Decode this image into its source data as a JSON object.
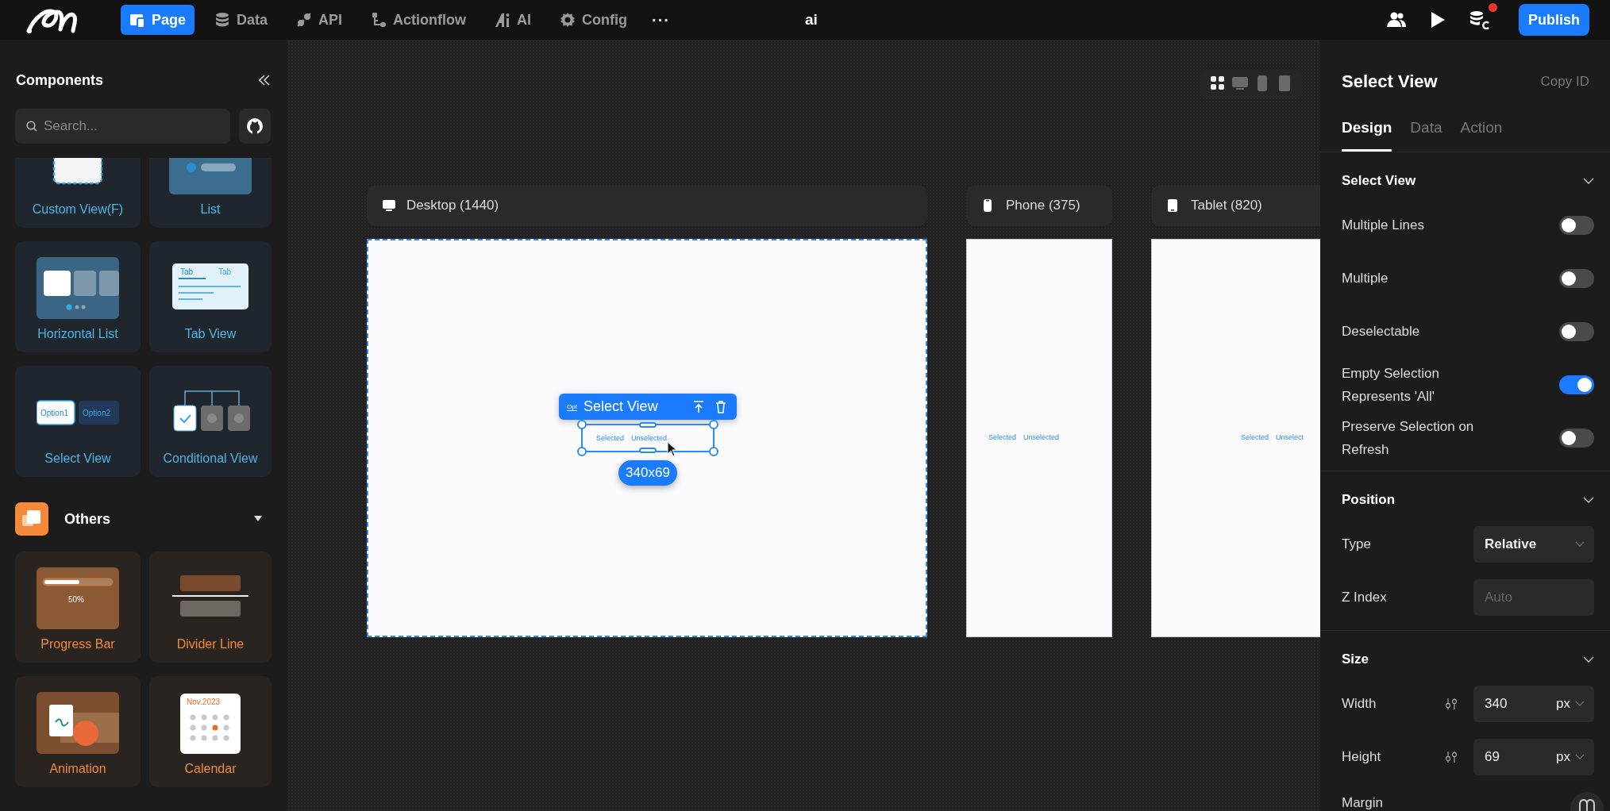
{
  "topbar": {
    "nav": [
      {
        "kind": "page",
        "label": "Page",
        "selected": true
      },
      {
        "kind": "data",
        "label": "Data",
        "selected": false
      },
      {
        "kind": "api",
        "label": "API",
        "selected": false
      },
      {
        "kind": "actionflow",
        "label": "Actionflow",
        "selected": false
      },
      {
        "kind": "ai",
        "label": "AI",
        "selected": false
      },
      {
        "kind": "config",
        "label": "Config",
        "selected": false
      }
    ],
    "more": "···",
    "project_name": "ai",
    "has_notification": true,
    "publish": "Publish"
  },
  "components_panel": {
    "title": "Components",
    "search": {
      "placeholder": "Search..."
    },
    "sections": [
      {
        "kind": "layout",
        "rows": [
          {
            "cards": [
              {
                "kind": "custom-view",
                "label": "Custom View(F)"
              },
              {
                "kind": "list",
                "label": "List"
              }
            ]
          },
          {
            "cards": [
              {
                "kind": "horizontal-list",
                "label": "Horizontal List"
              },
              {
                "kind": "tab-view",
                "thumb_texts": [
                  "Tab",
                  "Tab"
                ],
                "label": "Tab View"
              }
            ]
          },
          {
            "cards": [
              {
                "kind": "select-view",
                "thumb_texts": [
                  "Option1",
                  "Option2"
                ],
                "label": "Select View"
              },
              {
                "kind": "conditional-view",
                "label": "Conditional View"
              }
            ]
          }
        ]
      },
      {
        "kind": "others",
        "title": "Others",
        "expanded": true,
        "rows": [
          {
            "cards": [
              {
                "kind": "progress-bar",
                "thumb_texts": [
                  "50%"
                ],
                "label": "Progress Bar"
              },
              {
                "kind": "divider-line",
                "label": "Divider Line"
              }
            ]
          },
          {
            "cards": [
              {
                "kind": "animation",
                "label": "Animation"
              },
              {
                "kind": "calendar",
                "thumb_texts": [
                  "Nov.2023"
                ],
                "label": "Calendar"
              }
            ]
          }
        ]
      }
    ]
  },
  "canvas": {
    "view_modes": [
      {
        "kind": "all",
        "selected": true
      },
      {
        "kind": "desktop",
        "selected": false
      },
      {
        "kind": "phone",
        "selected": false
      },
      {
        "kind": "tablet",
        "selected": false
      }
    ],
    "devices": [
      {
        "kind": "desktop",
        "label": "Desktop (1440)",
        "selected": true,
        "items": [
          "Selected",
          "Unselected"
        ]
      },
      {
        "kind": "phone",
        "label": "Phone (375)",
        "selected": false,
        "items": [
          "Selected",
          "Unselected"
        ]
      },
      {
        "kind": "tablet",
        "label": "Tablet (820)",
        "selected": false,
        "items": [
          "Selected",
          "Unselect"
        ]
      }
    ],
    "selection": {
      "icon_text": "Opt",
      "title": "Select View",
      "size": "340x69"
    }
  },
  "inspector": {
    "title": "Select View",
    "copy_id": "Copy ID",
    "tabs": [
      {
        "label": "Design",
        "selected": true
      },
      {
        "label": "Data",
        "selected": false
      },
      {
        "label": "Action",
        "selected": false
      }
    ],
    "sections": [
      {
        "title": "Select View",
        "expanded": true,
        "rows": [
          {
            "kind": "toggle",
            "label": "Multiple Lines",
            "on": false
          },
          {
            "kind": "toggle",
            "label": "Multiple",
            "on": false
          },
          {
            "kind": "toggle",
            "label": "Deselectable",
            "on": false
          },
          {
            "kind": "toggle",
            "label": "Empty Selection Represents 'All'",
            "on": true
          },
          {
            "kind": "toggle",
            "label": "Preserve Selection on Refresh",
            "on": false
          }
        ]
      },
      {
        "title": "Position",
        "expanded": true,
        "rows": [
          {
            "kind": "select",
            "label": "Type",
            "value": "Relative"
          },
          {
            "kind": "input",
            "label": "Z Index",
            "placeholder": "Auto"
          }
        ]
      },
      {
        "title": "Size",
        "expanded": true,
        "rows": [
          {
            "kind": "unit-input",
            "label": "Width",
            "value": "340",
            "unit": "px"
          },
          {
            "kind": "unit-input",
            "label": "Height",
            "value": "69",
            "unit": "px"
          },
          {
            "kind": "label",
            "label": "Margin"
          }
        ]
      }
    ]
  }
}
